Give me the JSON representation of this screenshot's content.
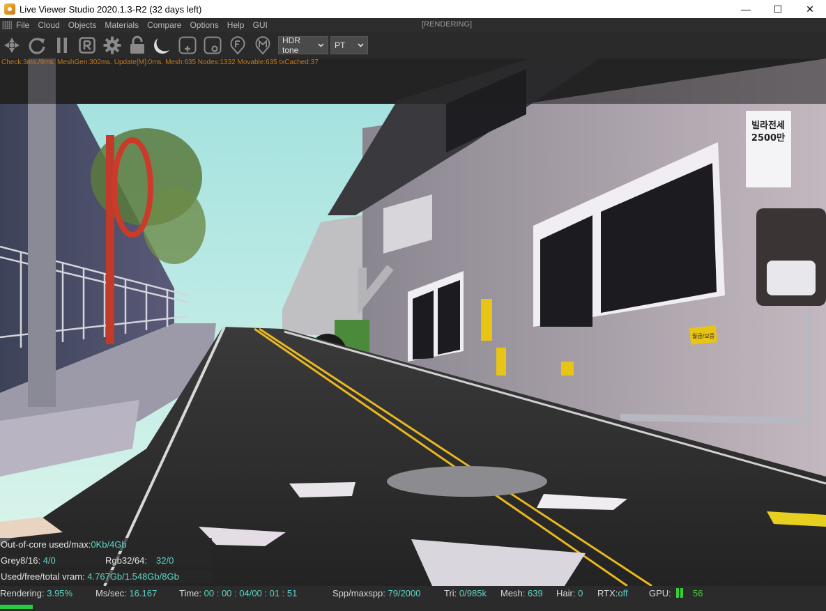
{
  "window": {
    "title": "Live Viewer Studio 2020.1.3-R2 (32 days left)",
    "minimize": "—",
    "maximize": "☐",
    "close": "✕"
  },
  "menu": {
    "items": [
      "File",
      "Cloud",
      "Objects",
      "Materials",
      "Compare",
      "Options",
      "Help",
      "GUI"
    ],
    "status": "[RENDERING]"
  },
  "toolbar": {
    "icons": [
      "send-scene-icon",
      "restart-icon",
      "pause-icon",
      "region-icon",
      "settings-gear-icon",
      "lock-icon",
      "sphere-icon",
      "add-region-icon",
      "clay-icon",
      "focus-picker-icon",
      "material-picker-icon"
    ],
    "tonemap": {
      "value": "HDR tone",
      "options": [
        "HDR tone"
      ]
    },
    "kernel": {
      "value": "PT",
      "options": [
        "PT"
      ]
    }
  },
  "viewport": {
    "stats_line": "Check:3ms./9ms. MeshGen:302ms. Update[M]:0ms. Mesh:635 Nodes:1332 Movable:635 txCached:37",
    "overlays": {
      "out_of_core_label": "Out-of-core used/max:",
      "out_of_core_value": "0Kb/4Gb",
      "grey_label": "Grey8/16:",
      "grey_value": "4/0",
      "rgb_label": "Rgb32/64:",
      "rgb_value": "32/0",
      "vram_label": "Used/free/total vram:",
      "vram_value": "4.767Gb/1.548Gb/8Gb"
    },
    "sign_text": [
      "빌라전세",
      "2500만"
    ],
    "poster_text": "월급/보증"
  },
  "status_bar": {
    "rendering_label": "Rendering:",
    "rendering_value": "3.95%",
    "mssec_label": "Ms/sec:",
    "mssec_value": "16.167",
    "time_label": "Time:",
    "time_value": "00 : 00 : 04/00 : 01 : 51",
    "spp_label": "Spp/maxspp:",
    "spp_value": "79/2000",
    "tri_label": "Tri:",
    "tri_value": "0/985k",
    "mesh_label": "Mesh:",
    "mesh_value": "639",
    "hair_label": "Hair:",
    "hair_value": "0",
    "rtx_label": "RTX:",
    "rtx_value": "off",
    "gpu_label": "GPU:",
    "gpu_value": "56",
    "progress": 0.0395
  },
  "colors": {
    "accent_cyan": "#5ed6c8",
    "stats_orange": "#c87a18",
    "progress_green": "#22cc44"
  }
}
